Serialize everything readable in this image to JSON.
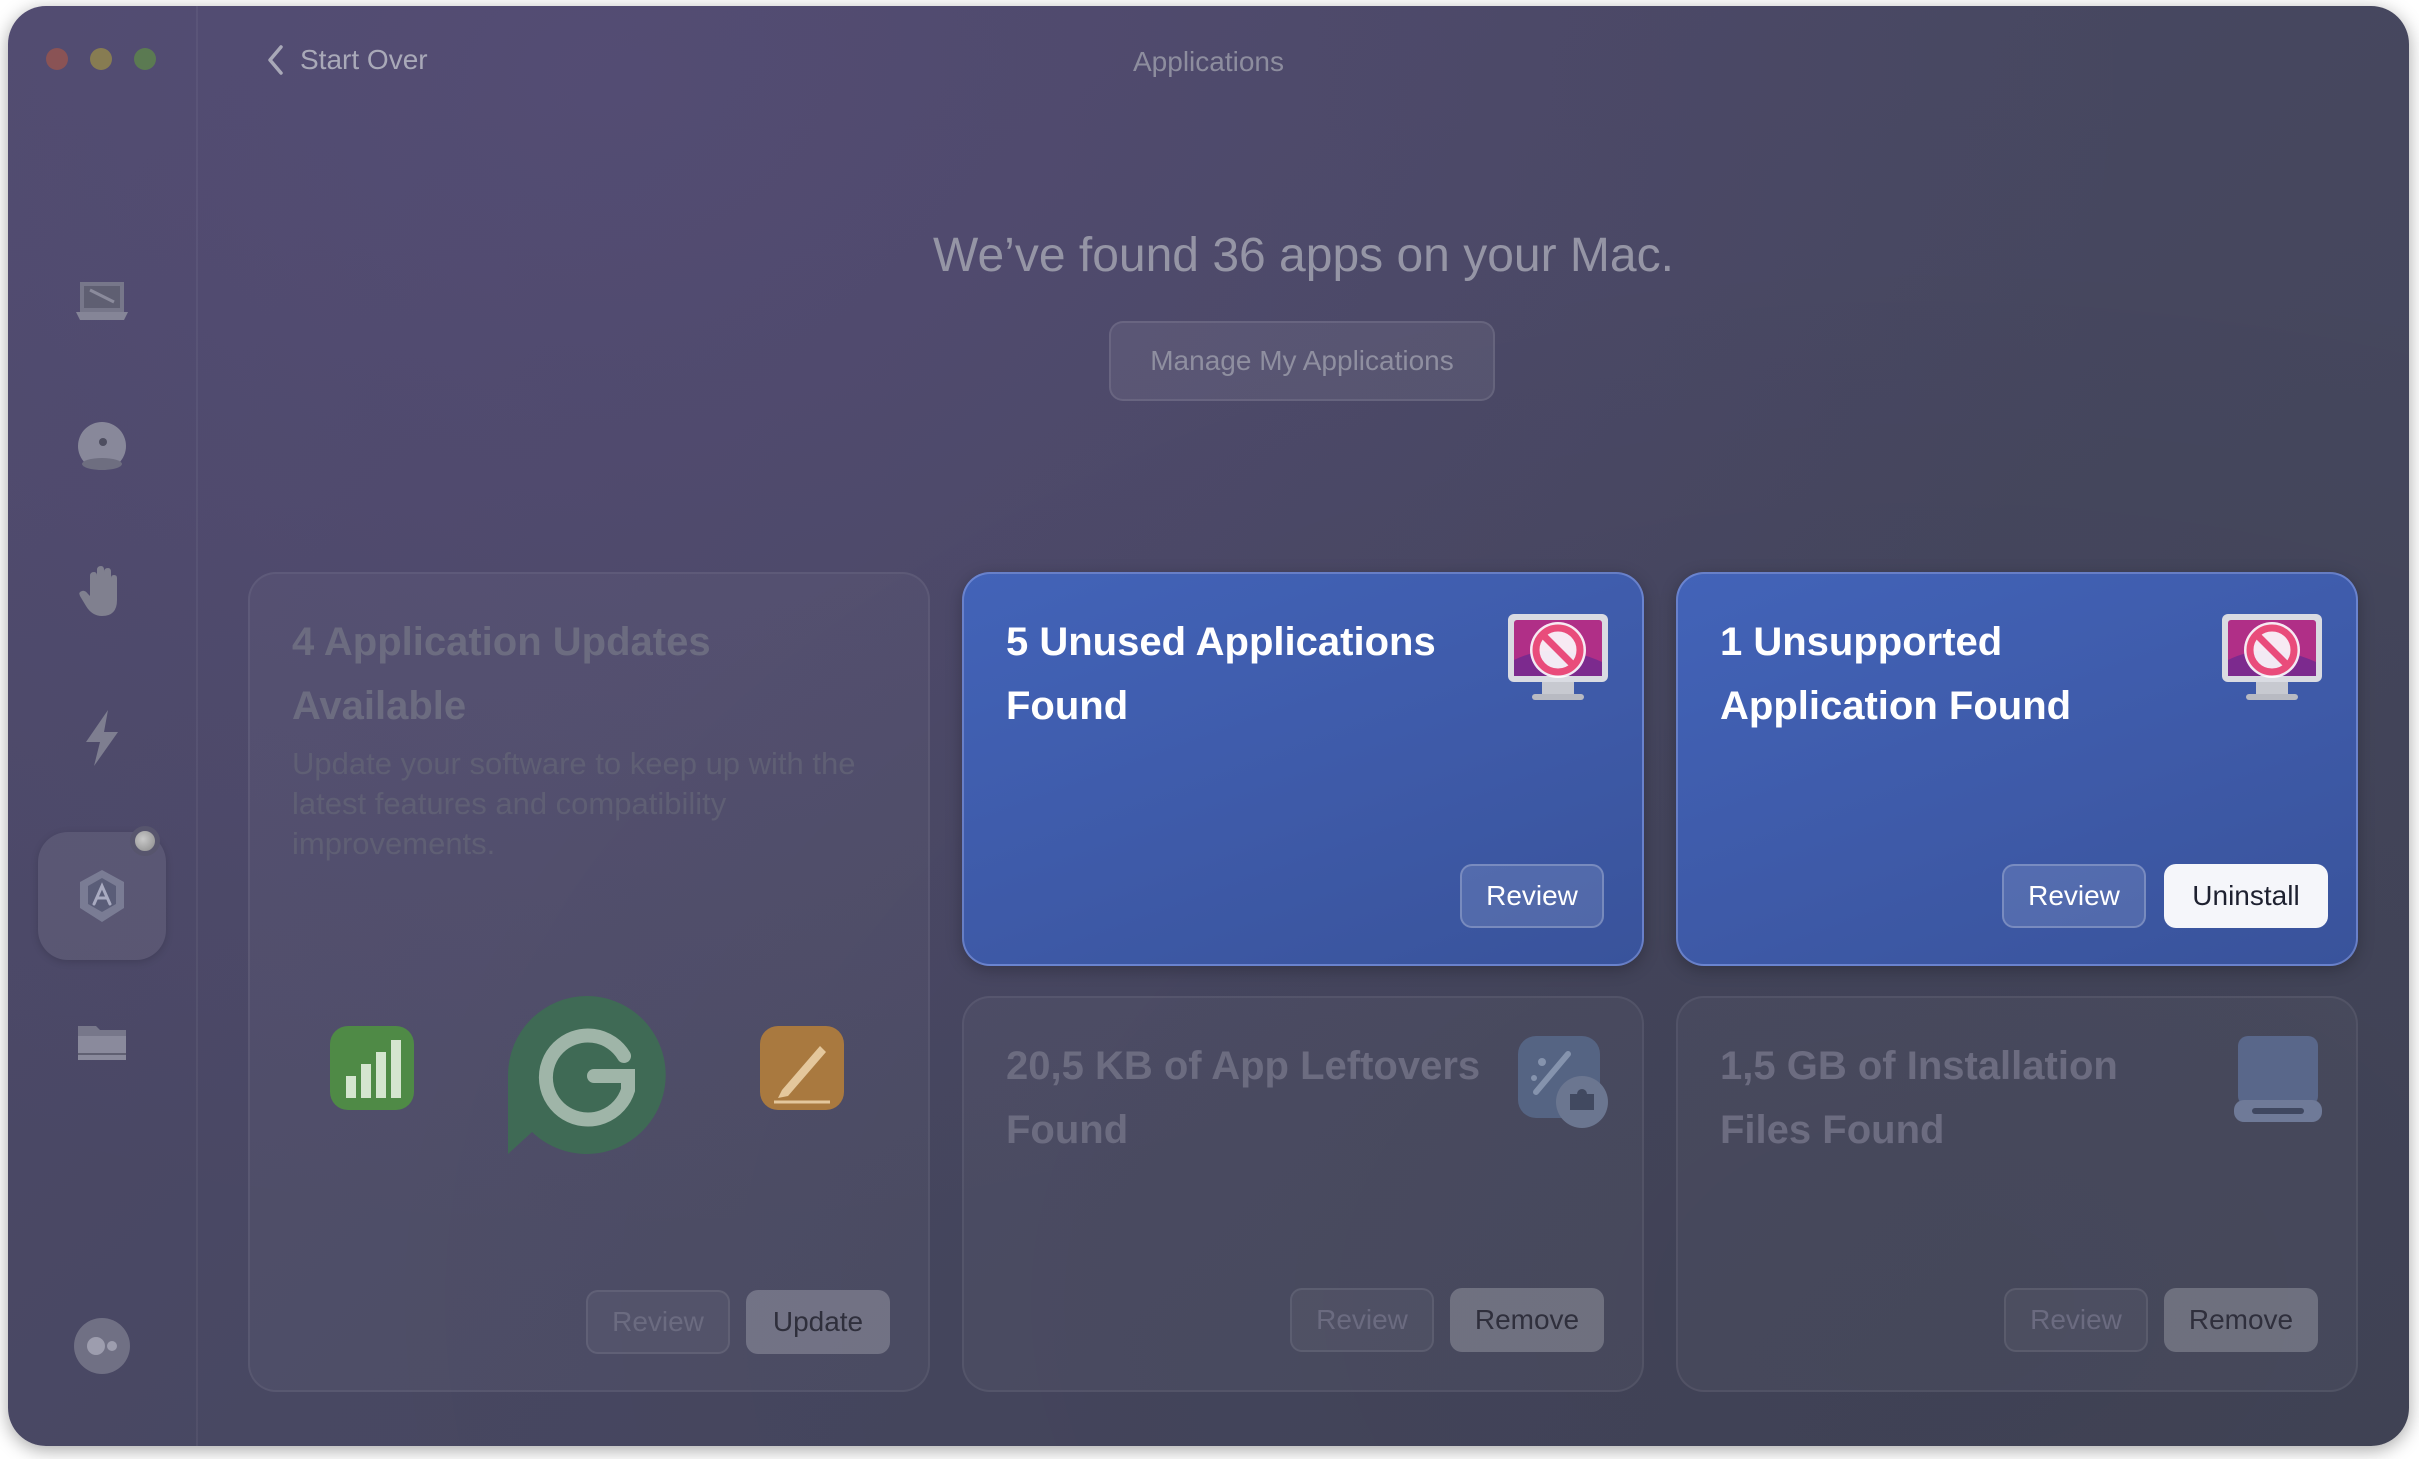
{
  "window": {
    "title": "Applications",
    "back_label": "Start Over"
  },
  "sidebar": {
    "items": [
      {
        "name": "smart-care",
        "icon": "monitor-tray-icon"
      },
      {
        "name": "cleanup",
        "icon": "sphere-icon"
      },
      {
        "name": "protection",
        "icon": "hand-icon"
      },
      {
        "name": "performance",
        "icon": "lightning-icon"
      },
      {
        "name": "applications",
        "icon": "app-hexagon-icon",
        "active": true
      },
      {
        "name": "my-clutter",
        "icon": "folder-icon"
      },
      {
        "name": "assistant",
        "icon": "assistant-dots-icon"
      }
    ]
  },
  "main": {
    "headline": "We’ve found 36 apps on your Mac.",
    "manage_button": "Manage My Applications"
  },
  "cards": {
    "updates": {
      "title_line1": "4 Application Updates",
      "title_line2": "Available",
      "description": "Update your software to keep up with the latest features and compatibility improvements.",
      "review_label": "Review",
      "action_label": "Update",
      "apps": [
        "numbers-app-icon",
        "grammarly-app-icon",
        "pages-app-icon"
      ]
    },
    "unused": {
      "title_line1": "5 Unused Applications",
      "title_line2": "Found",
      "review_label": "Review"
    },
    "unsupported": {
      "title_line1": "1 Unsupported",
      "title_line2": "Application Found",
      "review_label": "Review",
      "action_label": "Uninstall"
    },
    "leftovers": {
      "title_line1": "20,5 KB of App Leftovers",
      "title_line2": "Found",
      "review_label": "Review",
      "action_label": "Remove"
    },
    "installation": {
      "title_line1": "1,5 GB of Installation",
      "title_line2": "Files Found",
      "review_label": "Review",
      "action_label": "Remove"
    }
  },
  "colors": {
    "highlight_card": "#4263b8",
    "window_bg": "#4a4865"
  }
}
